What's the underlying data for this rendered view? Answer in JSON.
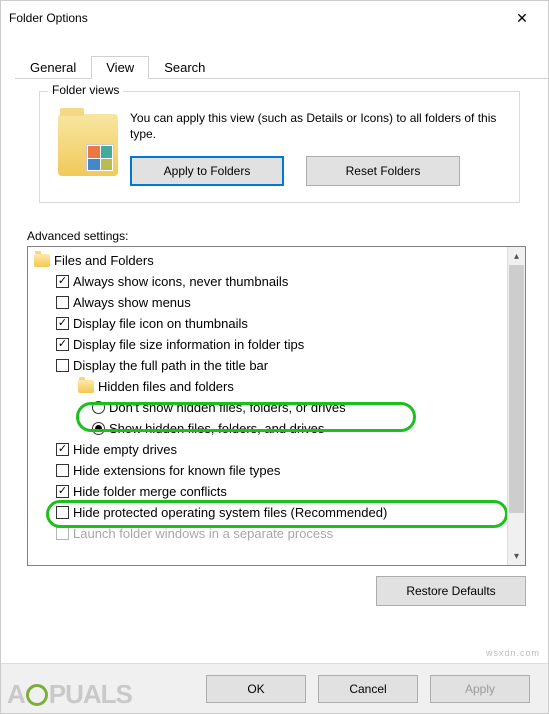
{
  "window": {
    "title": "Folder Options"
  },
  "tabs": {
    "general": "General",
    "view": "View",
    "search": "Search"
  },
  "folderViews": {
    "legend": "Folder views",
    "desc": "You can apply this view (such as Details or Icons) to all folders of this type.",
    "applyBtn": "Apply to Folders",
    "resetBtn": "Reset Folders"
  },
  "advanced": {
    "label": "Advanced settings:",
    "root": "Files and Folders",
    "items": {
      "alwaysIcons": "Always show icons, never thumbnails",
      "alwaysMenus": "Always show menus",
      "displayIconThumb": "Display file icon on thumbnails",
      "displaySizeTips": "Display file size information in folder tips",
      "displayFullPath": "Display the full path in the title bar",
      "hiddenGroup": "Hidden files and folders",
      "dontShowHidden": "Don't show hidden files, folders, or drives",
      "showHidden": "Show hidden files, folders, and drives",
      "hideEmpty": "Hide empty drives",
      "hideExt": "Hide extensions for known file types",
      "hideMerge": "Hide folder merge conflicts",
      "hideProtected": "Hide protected operating system files (Recommended)",
      "launchSeparate": "Launch folder windows in a separate process"
    },
    "restore": "Restore Defaults"
  },
  "footer": {
    "ok": "OK",
    "cancel": "Cancel",
    "apply": "Apply"
  },
  "watermark": "wsxdn.com"
}
